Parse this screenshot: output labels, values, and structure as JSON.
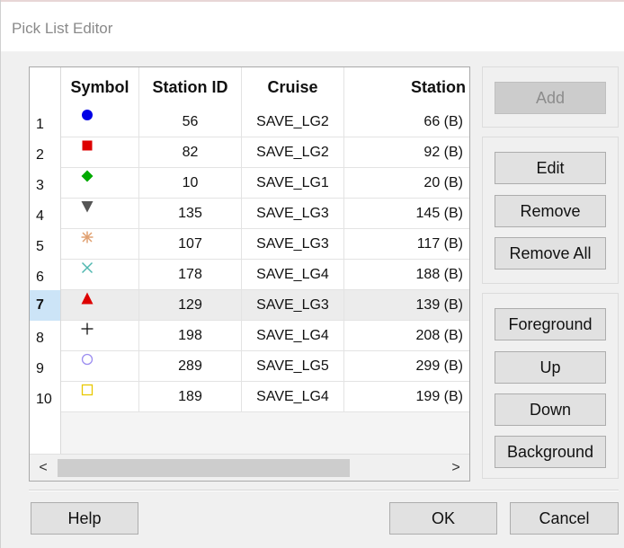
{
  "window": {
    "title": "Pick List Editor"
  },
  "grid": {
    "columns": [
      "Symbol",
      "Station ID",
      "Cruise",
      "Station"
    ],
    "selected_row_index": 7,
    "rows": [
      {
        "num": "1",
        "symbol": "blue-filled-circle",
        "station_id": "56",
        "cruise": "SAVE_LG2",
        "station": "66 (B)"
      },
      {
        "num": "2",
        "symbol": "red-filled-square",
        "station_id": "82",
        "cruise": "SAVE_LG2",
        "station": "92 (B)"
      },
      {
        "num": "3",
        "symbol": "green-filled-diamond",
        "station_id": "10",
        "cruise": "SAVE_LG1",
        "station": "20 (B)"
      },
      {
        "num": "4",
        "symbol": "gray-filled-down-triangle",
        "station_id": "135",
        "cruise": "SAVE_LG3",
        "station": "145 (B)"
      },
      {
        "num": "5",
        "symbol": "orange-asterisk",
        "station_id": "107",
        "cruise": "SAVE_LG3",
        "station": "117 (B)"
      },
      {
        "num": "6",
        "symbol": "teal-x-cross",
        "station_id": "178",
        "cruise": "SAVE_LG4",
        "station": "188 (B)"
      },
      {
        "num": "7",
        "symbol": "red-filled-up-triangle",
        "station_id": "129",
        "cruise": "SAVE_LG3",
        "station": "139 (B)"
      },
      {
        "num": "8",
        "symbol": "black-plus",
        "station_id": "198",
        "cruise": "SAVE_LG4",
        "station": "208 (B)"
      },
      {
        "num": "9",
        "symbol": "lavender-open-circle",
        "station_id": "289",
        "cruise": "SAVE_LG5",
        "station": "299 (B)"
      },
      {
        "num": "10",
        "symbol": "yellow-open-square",
        "station_id": "189",
        "cruise": "SAVE_LG4",
        "station": "199 (B)"
      }
    ],
    "scroll_left_glyph": "<",
    "scroll_right_glyph": ">"
  },
  "buttons": {
    "add": "Add",
    "edit": "Edit",
    "remove": "Remove",
    "remove_all": "Remove All",
    "foreground": "Foreground",
    "up": "Up",
    "down": "Down",
    "background": "Background",
    "help": "Help",
    "ok": "OK",
    "cancel": "Cancel"
  },
  "colors": {
    "blue": "#0000e6",
    "red": "#dd0000",
    "green": "#00aa00",
    "gray": "#555555",
    "orange": "#e0a070",
    "teal": "#4fb8b0",
    "black": "#111111",
    "lavender": "#9c8ef0",
    "yellow": "#e8c800",
    "selection": "#cce4f7"
  }
}
